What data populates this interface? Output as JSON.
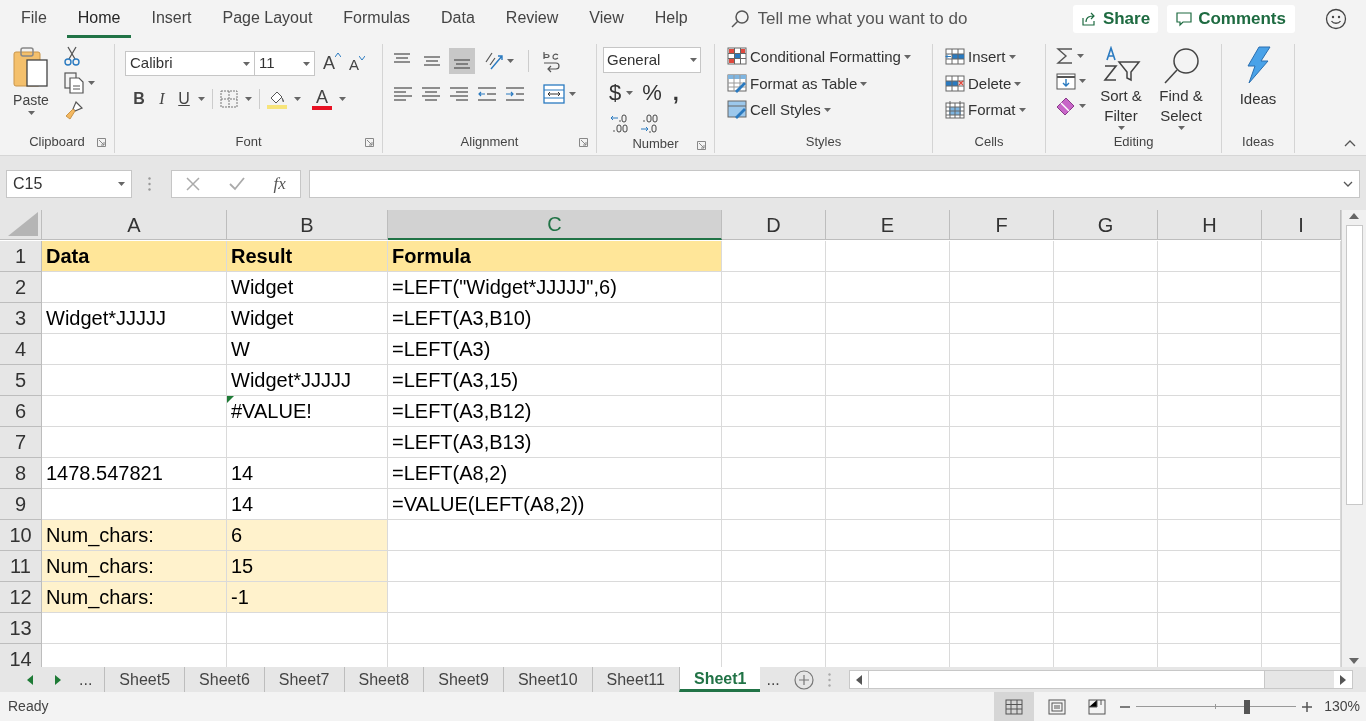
{
  "menu_tabs": [
    {
      "label": "File",
      "selected": false
    },
    {
      "label": "Home",
      "selected": true
    },
    {
      "label": "Insert",
      "selected": false
    },
    {
      "label": "Page Layout",
      "selected": false
    },
    {
      "label": "Formulas",
      "selected": false
    },
    {
      "label": "Data",
      "selected": false
    },
    {
      "label": "Review",
      "selected": false
    },
    {
      "label": "View",
      "selected": false
    },
    {
      "label": "Help",
      "selected": false
    }
  ],
  "tell_me": {
    "placeholder": "Tell me what you want to do"
  },
  "header_buttons": {
    "share": "Share",
    "comments": "Comments"
  },
  "ribbon": {
    "clipboard": {
      "label": "Clipboard",
      "paste": "Paste"
    },
    "font": {
      "label": "Font",
      "font_name": "Calibri",
      "font_size": "11",
      "grow": "A",
      "shrink": "A",
      "bold": "B",
      "italic": "I",
      "underline": "U",
      "font_color": "A"
    },
    "alignment": {
      "label": "Alignment",
      "vertical": [
        {
          "selected": false
        },
        {
          "selected": false
        },
        {
          "selected": true
        }
      ]
    },
    "number": {
      "label": "Number",
      "format": "General",
      "currency": "$",
      "percent": "%",
      "comma": ","
    },
    "styles": {
      "label": "Styles",
      "items": [
        "Conditional Formatting",
        "Format as Table",
        "Cell Styles"
      ]
    },
    "cells": {
      "label": "Cells",
      "items": [
        "Insert",
        "Delete",
        "Format"
      ]
    },
    "editing": {
      "label": "Editing",
      "sort": "Sort & Filter",
      "find": "Find & Select"
    },
    "ideas": {
      "label": "Ideas",
      "button": "Ideas"
    }
  },
  "formula_bar": {
    "name_box": "C15",
    "fx": "fx"
  },
  "columns": [
    {
      "label": "A",
      "selected": false
    },
    {
      "label": "B",
      "selected": false
    },
    {
      "label": "C",
      "selected": true
    },
    {
      "label": "D",
      "selected": false
    },
    {
      "label": "E",
      "selected": false
    },
    {
      "label": "F",
      "selected": false
    },
    {
      "label": "G",
      "selected": false
    },
    {
      "label": "H",
      "selected": false
    },
    {
      "label": "I",
      "selected": false
    }
  ],
  "rows": [
    {
      "number": "1",
      "kind": "header",
      "warning": false,
      "cells": {
        "A": "Data",
        "B": "Result",
        "C": "Formula"
      }
    },
    {
      "number": "2",
      "kind": "plain",
      "warning": false,
      "cells": {
        "B": "Widget",
        "C": "=LEFT(\"Widget*JJJJJ\",6)"
      }
    },
    {
      "number": "3",
      "kind": "plain",
      "warning": false,
      "cells": {
        "A": "Widget*JJJJJ",
        "B": "Widget",
        "C": "=LEFT(A3,B10)"
      }
    },
    {
      "number": "4",
      "kind": "plain",
      "warning": false,
      "cells": {
        "B": "W",
        "C": "=LEFT(A3)"
      }
    },
    {
      "number": "5",
      "kind": "plain",
      "warning": false,
      "cells": {
        "B": "Widget*JJJJJ",
        "C": "=LEFT(A3,15)"
      }
    },
    {
      "number": "6",
      "kind": "plain",
      "warning": true,
      "cells": {
        "B": "#VALUE!",
        "C": "=LEFT(A3,B12)"
      }
    },
    {
      "number": "7",
      "kind": "plain",
      "warning": false,
      "cells": {
        "C": "=LEFT(A3,B13)"
      }
    },
    {
      "number": "8",
      "kind": "plain",
      "warning": false,
      "cells": {
        "A": "1478.547821",
        "B": "14",
        "C": "=LEFT(A8,2)"
      }
    },
    {
      "number": "9",
      "kind": "plain",
      "warning": false,
      "cells": {
        "B": "14",
        "C": "=VALUE(LEFT(A8,2))"
      }
    },
    {
      "number": "10",
      "kind": "input",
      "warning": false,
      "cells": {
        "A": "Num_chars:",
        "B": "6"
      }
    },
    {
      "number": "11",
      "kind": "input",
      "warning": false,
      "cells": {
        "A": "Num_chars:",
        "B": "15"
      }
    },
    {
      "number": "12",
      "kind": "input",
      "warning": false,
      "cells": {
        "A": "Num_chars:",
        "B": "-1"
      }
    },
    {
      "number": "13",
      "kind": "plain",
      "warning": false
    },
    {
      "number": "14",
      "kind": "plain",
      "warning": false
    }
  ],
  "sheet_tabs": {
    "more_left": "...",
    "tabs": [
      {
        "label": "Sheet5",
        "selected": false
      },
      {
        "label": "Sheet6",
        "selected": false
      },
      {
        "label": "Sheet7",
        "selected": false
      },
      {
        "label": "Sheet8",
        "selected": false
      },
      {
        "label": "Sheet9",
        "selected": false
      },
      {
        "label": "Sheet10",
        "selected": false
      },
      {
        "label": "Sheet11",
        "selected": false
      },
      {
        "label": "Sheet1",
        "selected": true
      }
    ],
    "more_right": "..."
  },
  "status_bar": {
    "status": "Ready",
    "zoom": {
      "level": 0.7
    },
    "zoom_label": "130%"
  }
}
